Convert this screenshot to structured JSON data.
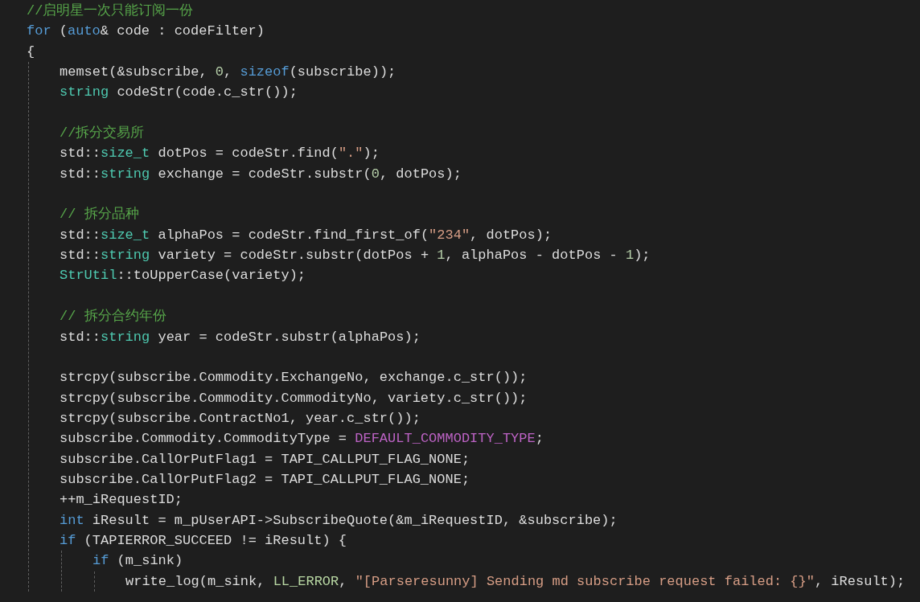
{
  "editor": {
    "lines": [
      {
        "kind": "code",
        "tokens": [
          {
            "kind": "comment",
            "text": "//启明星一次只能订阅一份"
          }
        ]
      },
      {
        "kind": "code",
        "tokens": [
          {
            "kind": "keyword",
            "text": "for"
          },
          {
            "kind": "plain",
            "text": " ("
          },
          {
            "kind": "keyword",
            "text": "auto"
          },
          {
            "kind": "plain",
            "text": "& code : codeFilter)"
          }
        ]
      },
      {
        "kind": "code",
        "tokens": [
          {
            "kind": "plain",
            "text": "{"
          }
        ],
        "children": [
          {
            "kind": "code",
            "tokens": [
              {
                "kind": "plain",
                "text": "memset(&subscribe, "
              },
              {
                "kind": "number",
                "text": "0"
              },
              {
                "kind": "plain",
                "text": ", "
              },
              {
                "kind": "keyword",
                "text": "sizeof"
              },
              {
                "kind": "plain",
                "text": "(subscribe));"
              }
            ]
          },
          {
            "kind": "code",
            "tokens": [
              {
                "kind": "type",
                "text": "string"
              },
              {
                "kind": "plain",
                "text": " codeStr(code.c_str());"
              }
            ]
          },
          {
            "kind": "blank"
          },
          {
            "kind": "code",
            "tokens": [
              {
                "kind": "comment",
                "text": "//拆分交易所"
              }
            ]
          },
          {
            "kind": "code",
            "tokens": [
              {
                "kind": "plain",
                "text": "std::"
              },
              {
                "kind": "type",
                "text": "size_t"
              },
              {
                "kind": "plain",
                "text": " dotPos = codeStr.find("
              },
              {
                "kind": "string",
                "text": "\".\""
              },
              {
                "kind": "plain",
                "text": ");"
              }
            ]
          },
          {
            "kind": "code",
            "tokens": [
              {
                "kind": "plain",
                "text": "std::"
              },
              {
                "kind": "type",
                "text": "string"
              },
              {
                "kind": "plain",
                "text": " exchange = codeStr.substr("
              },
              {
                "kind": "number",
                "text": "0"
              },
              {
                "kind": "plain",
                "text": ", dotPos);"
              }
            ]
          },
          {
            "kind": "blank"
          },
          {
            "kind": "code",
            "tokens": [
              {
                "kind": "comment",
                "text": "// 拆分品种"
              }
            ]
          },
          {
            "kind": "code",
            "tokens": [
              {
                "kind": "plain",
                "text": "std::"
              },
              {
                "kind": "type",
                "text": "size_t"
              },
              {
                "kind": "plain",
                "text": " alphaPos = codeStr.find_first_of("
              },
              {
                "kind": "string",
                "text": "\"234\""
              },
              {
                "kind": "plain",
                "text": ", dotPos);"
              }
            ]
          },
          {
            "kind": "code",
            "tokens": [
              {
                "kind": "plain",
                "text": "std::"
              },
              {
                "kind": "type",
                "text": "string"
              },
              {
                "kind": "plain",
                "text": " variety = codeStr.substr(dotPos + "
              },
              {
                "kind": "number",
                "text": "1"
              },
              {
                "kind": "plain",
                "text": ", alphaPos - dotPos - "
              },
              {
                "kind": "number",
                "text": "1"
              },
              {
                "kind": "plain",
                "text": ");"
              }
            ]
          },
          {
            "kind": "code",
            "tokens": [
              {
                "kind": "type",
                "text": "StrUtil"
              },
              {
                "kind": "plain",
                "text": "::toUpperCase(variety);"
              }
            ]
          },
          {
            "kind": "blank"
          },
          {
            "kind": "code",
            "tokens": [
              {
                "kind": "comment",
                "text": "// 拆分合约年份"
              }
            ]
          },
          {
            "kind": "code",
            "tokens": [
              {
                "kind": "plain",
                "text": "std::"
              },
              {
                "kind": "type",
                "text": "string"
              },
              {
                "kind": "plain",
                "text": " year = codeStr.substr(alphaPos);"
              }
            ]
          },
          {
            "kind": "blank"
          },
          {
            "kind": "code",
            "tokens": [
              {
                "kind": "plain",
                "text": "strcpy(subscribe.Commodity.ExchangeNo, exchange.c_str());"
              }
            ]
          },
          {
            "kind": "code",
            "tokens": [
              {
                "kind": "plain",
                "text": "strcpy(subscribe.Commodity.CommodityNo, variety.c_str());"
              }
            ]
          },
          {
            "kind": "code",
            "tokens": [
              {
                "kind": "plain",
                "text": "strcpy(subscribe.ContractNo1, year.c_str());"
              }
            ]
          },
          {
            "kind": "code",
            "tokens": [
              {
                "kind": "plain",
                "text": "subscribe.Commodity.CommodityType = "
              },
              {
                "kind": "macro",
                "text": "DEFAULT_COMMODITY_TYPE"
              },
              {
                "kind": "plain",
                "text": ";"
              }
            ]
          },
          {
            "kind": "code",
            "tokens": [
              {
                "kind": "plain",
                "text": "subscribe.CallOrPutFlag1 = TAPI_CALLPUT_FLAG_NONE;"
              }
            ]
          },
          {
            "kind": "code",
            "tokens": [
              {
                "kind": "plain",
                "text": "subscribe.CallOrPutFlag2 = TAPI_CALLPUT_FLAG_NONE;"
              }
            ]
          },
          {
            "kind": "code",
            "tokens": [
              {
                "kind": "plain",
                "text": "++m_iRequestID;"
              }
            ]
          },
          {
            "kind": "code",
            "tokens": [
              {
                "kind": "keyword",
                "text": "int"
              },
              {
                "kind": "plain",
                "text": " iResult = m_pUserAPI->SubscribeQuote(&m_iRequestID, &subscribe);"
              }
            ]
          },
          {
            "kind": "code",
            "tokens": [
              {
                "kind": "keyword",
                "text": "if"
              },
              {
                "kind": "plain",
                "text": " (TAPIERROR_SUCCEED != iResult) {"
              }
            ],
            "children": [
              {
                "kind": "code",
                "tokens": [
                  {
                    "kind": "keyword",
                    "text": "if"
                  },
                  {
                    "kind": "plain",
                    "text": " (m_sink)"
                  }
                ],
                "children": [
                  {
                    "kind": "code",
                    "tokens": [
                      {
                        "kind": "plain",
                        "text": "write_log(m_sink, "
                      },
                      {
                        "kind": "enum",
                        "text": "LL_ERROR"
                      },
                      {
                        "kind": "plain",
                        "text": ", "
                      },
                      {
                        "kind": "string",
                        "text": "\"[Parseresunny] Sending md subscribe request failed: {}\""
                      },
                      {
                        "kind": "plain",
                        "text": ", iResult);"
                      }
                    ]
                  }
                ]
              }
            ]
          }
        ]
      }
    ]
  }
}
